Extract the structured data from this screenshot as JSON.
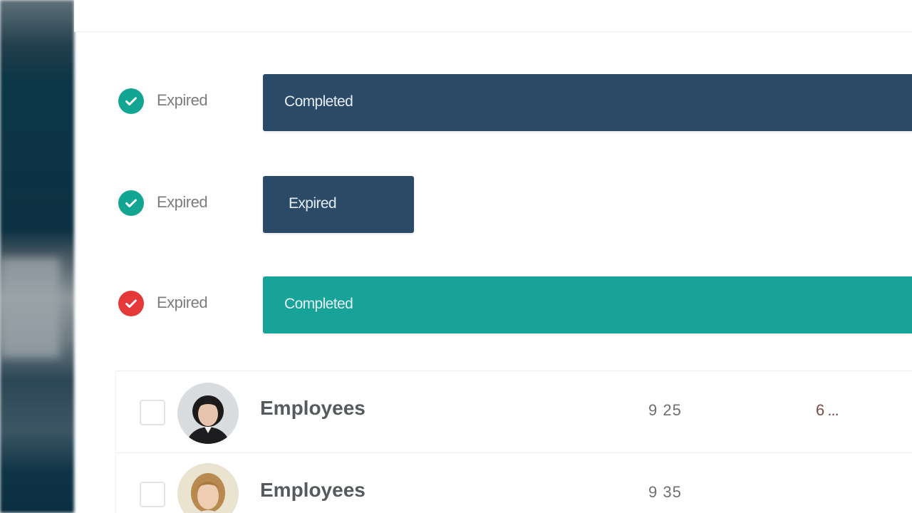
{
  "progress_rows": [
    {
      "status": "complete",
      "status_icon": "check-circle-icon",
      "status_color": "#11a592",
      "label": "Expired",
      "bar_text": "Completed",
      "bar_fraction": 1.0,
      "bar_color": "#2a4a68"
    },
    {
      "status": "complete",
      "status_icon": "check-circle-icon",
      "status_color": "#11a592",
      "label": "Expired",
      "bar_text": "Expired",
      "bar_fraction": 0.233,
      "bar_color": "#2a4a68"
    },
    {
      "status": "failed",
      "status_icon": "check-circle-icon",
      "status_color": "#e5383b",
      "label": "Expired",
      "bar_text": "Completed",
      "bar_fraction": 1.0,
      "bar_color": "#17a397"
    }
  ],
  "table": {
    "rows": [
      {
        "name": "Employees",
        "value": "9 25",
        "extra": "6 ..."
      },
      {
        "name": "Employees",
        "value": "9 35",
        "extra": ""
      }
    ]
  }
}
